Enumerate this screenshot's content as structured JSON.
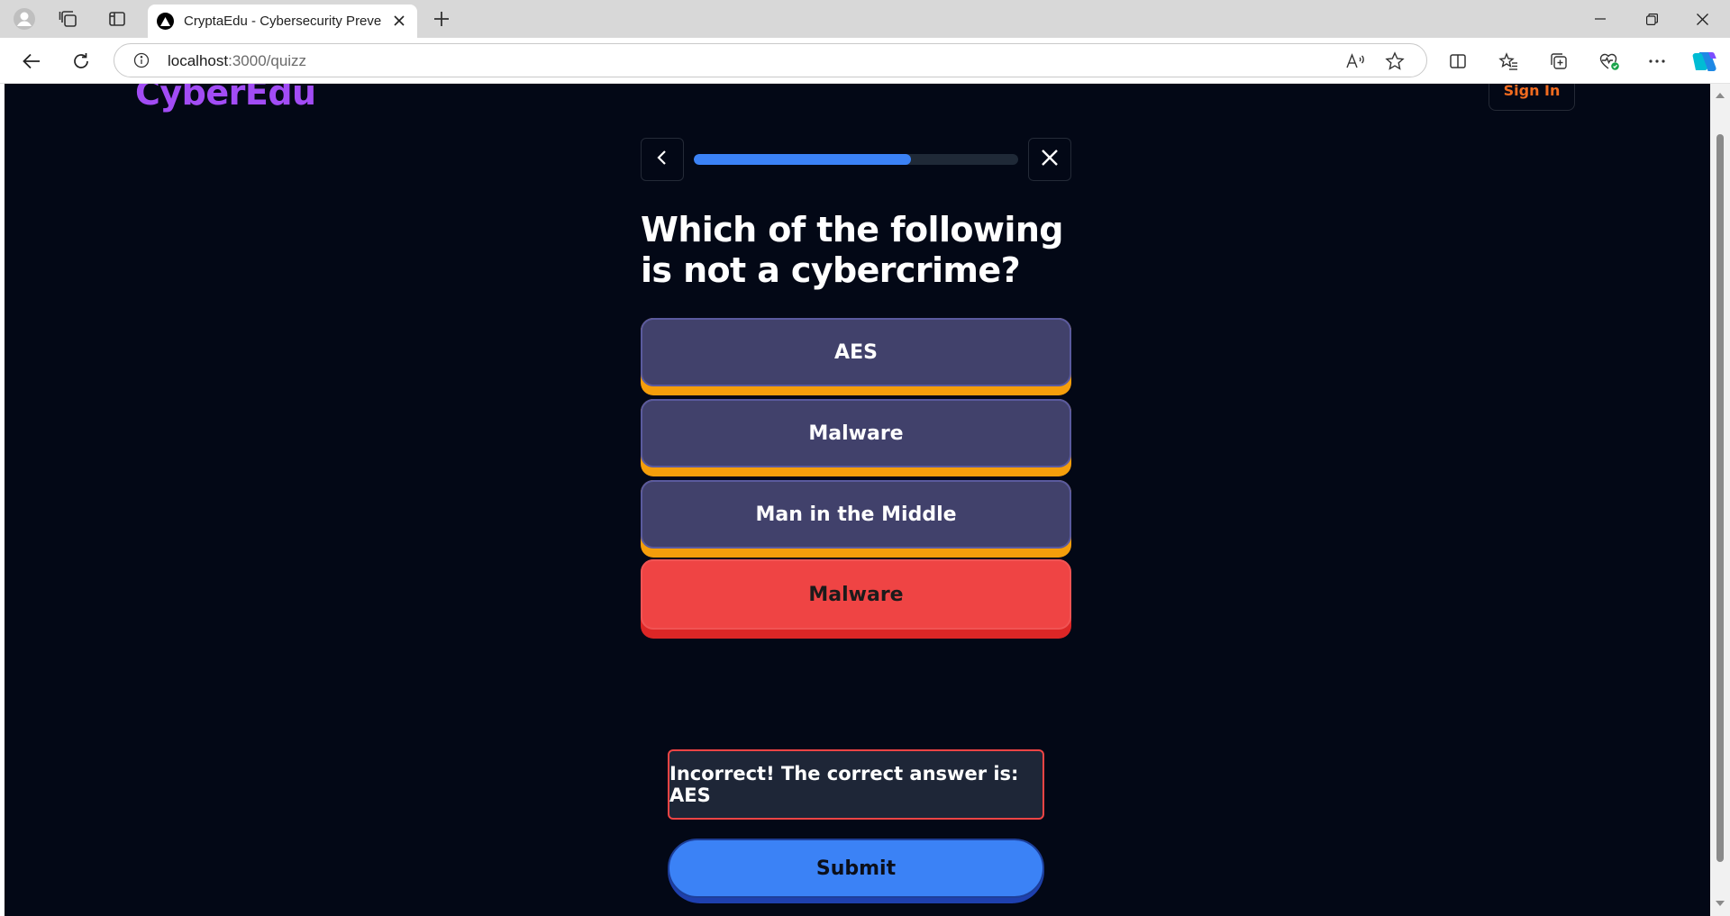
{
  "browser": {
    "tab_title": "CryptaEdu - Cybersecurity Preven",
    "url_host": "localhost",
    "url_path": ":3000/quizz",
    "icons": [
      "profile-icon",
      "workspaces-icon",
      "tab-actions-icon",
      "close-icon",
      "new-tab-icon",
      "minimize-icon",
      "restore-icon",
      "back-icon",
      "refresh-icon",
      "info-icon",
      "read-aloud-icon",
      "favorite-icon",
      "split-screen-icon",
      "favorites-icon",
      "collections-icon",
      "health-icon",
      "more-icon",
      "copilot-icon"
    ]
  },
  "site": {
    "logo": "CyberEdu",
    "sign_in": "Sign In"
  },
  "quiz": {
    "progress": 0.67,
    "question": "Which of the following is not a cybercrime?",
    "options": [
      {
        "label": "AES"
      },
      {
        "label": "Malware"
      },
      {
        "label": "Man in the Middle"
      },
      {
        "label": "Malware",
        "state": "selected-wrong"
      }
    ],
    "feedback": "Incorrect! The correct answer is: AES",
    "submit_label": "Submit"
  },
  "colors": {
    "page_bg": "#030816",
    "accent": "#3b82f6",
    "logo": "#a24cf5",
    "option_bg": "#41416b",
    "option_shadow": "#f59e0b",
    "error": "#ef4444"
  }
}
